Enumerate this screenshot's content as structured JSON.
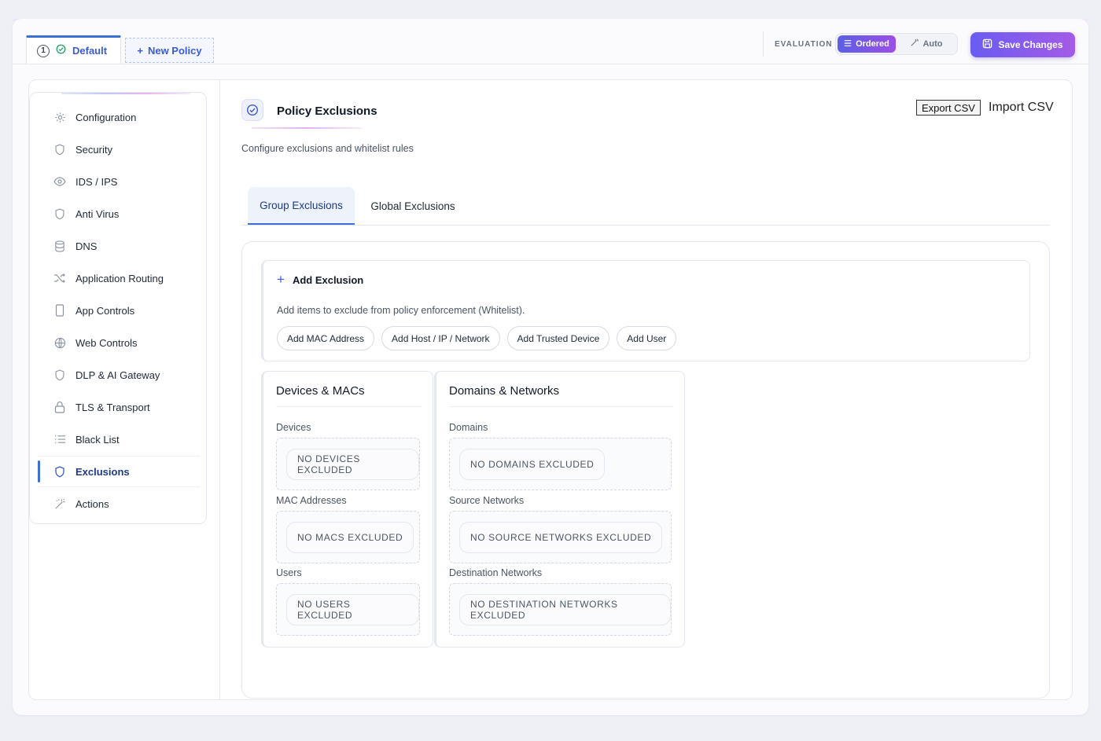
{
  "topbar": {
    "policy_number": "1",
    "default_tab": "Default",
    "new_policy": "New Policy",
    "evaluation_label": "EVALUATION",
    "mode_ordered": "Ordered",
    "mode_auto": "Auto",
    "save_label": "Save Changes"
  },
  "sidebar": {
    "items": [
      {
        "label": "Configuration",
        "icon": "gear-icon"
      },
      {
        "label": "Security",
        "icon": "shield-icon"
      },
      {
        "label": "IDS / IPS",
        "icon": "eye-icon"
      },
      {
        "label": "Anti Virus",
        "icon": "shield-icon"
      },
      {
        "label": "DNS",
        "icon": "database-icon"
      },
      {
        "label": "Application Routing",
        "icon": "shuffle-icon"
      },
      {
        "label": "App Controls",
        "icon": "phone-icon"
      },
      {
        "label": "Web Controls",
        "icon": "globe-icon"
      },
      {
        "label": "DLP & AI Gateway",
        "icon": "shield-icon"
      },
      {
        "label": "TLS & Transport",
        "icon": "lock-icon"
      },
      {
        "label": "Black List",
        "icon": "list-icon"
      },
      {
        "label": "Exclusions",
        "icon": "shield-icon",
        "active": true
      },
      {
        "label": "Actions",
        "icon": "wand-icon"
      }
    ]
  },
  "main": {
    "title": "Policy Exclusions",
    "subtitle": "Configure exclusions and whitelist rules",
    "export_label": "Export CSV",
    "import_label": "Import CSV",
    "tabs": [
      {
        "label": "Group Exclusions",
        "active": true
      },
      {
        "label": "Global Exclusions"
      }
    ],
    "add": {
      "title": "Add Exclusion",
      "description": "Add items to exclude from policy enforcement (Whitelist).",
      "buttons": [
        "Add MAC Address",
        "Add Host / IP / Network",
        "Add Trusted Device",
        "Add User"
      ]
    },
    "devices_panel": {
      "title": "Devices & MACs",
      "devices_label": "Devices",
      "devices_empty": "NO DEVICES EXCLUDED",
      "macs_label": "MAC Addresses",
      "macs_empty": "NO MACS EXCLUDED",
      "users_label": "Users",
      "users_empty": "NO USERS EXCLUDED"
    },
    "domains_panel": {
      "title": "Domains & Networks",
      "domains_label": "Domains",
      "domains_empty": "NO DOMAINS EXCLUDED",
      "source_label": "Source Networks",
      "source_empty": "NO SOURCE NETWORKS EXCLUDED",
      "dest_label": "Destination Networks",
      "dest_empty": "NO DESTINATION NETWORKS EXCLUDED"
    }
  },
  "colors": {
    "accent": "#3b5bd4",
    "save_gradient_start": "#6a5cf2",
    "save_gradient_end": "#a45be6"
  }
}
